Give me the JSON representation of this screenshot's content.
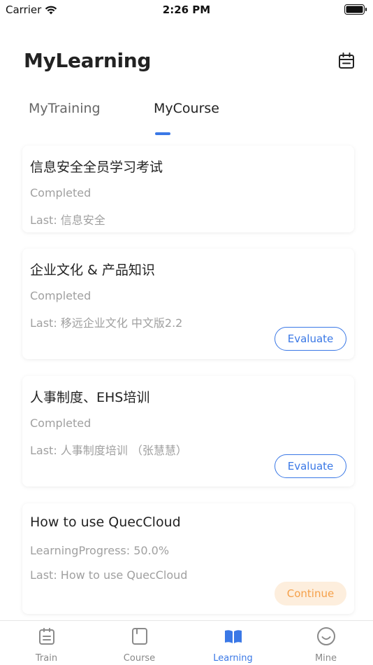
{
  "status_bar": {
    "carrier": "Carrier",
    "time": "2:26 PM"
  },
  "header": {
    "title": "MyLearning",
    "calendar_icon": "calendar-icon"
  },
  "tabs": [
    {
      "label": "MyTraining",
      "active": false
    },
    {
      "label": "MyCourse",
      "active": true
    }
  ],
  "courses": [
    {
      "title": "信息安全全员学习考试",
      "status": "Completed",
      "last": "Last: 信息安全",
      "action": ""
    },
    {
      "title": "企业文化 & 产品知识",
      "status": "Completed",
      "last": "Last: 移远企业文化 中文版2.2",
      "action": "Evaluate"
    },
    {
      "title": "人事制度、EHS培训",
      "status": "Completed",
      "last": "Last: 人事制度培训 （张慧慧）",
      "action": "Evaluate"
    },
    {
      "title": "How to use QuecCloud",
      "status": "LearningProgress: 50.0%",
      "last": "Last: How to use QuecCloud",
      "action": "Continue"
    }
  ],
  "tabbar": [
    {
      "label": "Train",
      "icon": "train-icon",
      "active": false
    },
    {
      "label": "Course",
      "icon": "course-icon",
      "active": false
    },
    {
      "label": "Learning",
      "icon": "book-open-icon",
      "active": true
    },
    {
      "label": "Mine",
      "icon": "smile-icon",
      "active": false
    }
  ],
  "colors": {
    "accent": "#3a78e6",
    "continue_text": "#f5a04a",
    "continue_bg": "#fdeedd"
  }
}
